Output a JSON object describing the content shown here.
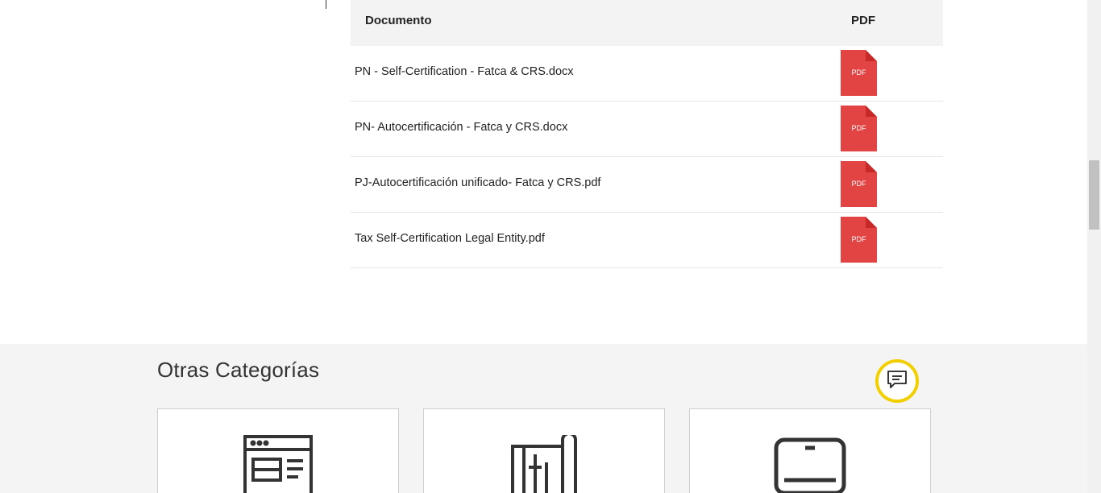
{
  "table": {
    "headers": {
      "document": "Documento",
      "pdf": "PDF"
    },
    "rows": [
      {
        "name": "PN - Self-Certification - Fatca & CRS.docx",
        "icon_label": "PDF"
      },
      {
        "name": "PN- Autocertificación - Fatca y CRS.docx",
        "icon_label": "PDF"
      },
      {
        "name": "PJ-Autocertificación unificado- Fatca y CRS.pdf",
        "icon_label": "PDF"
      },
      {
        "name": "Tax Self-Certification Legal Entity.pdf",
        "icon_label": "PDF"
      }
    ]
  },
  "other_categories": {
    "title": "Otras Categorías",
    "cards": [
      {
        "icon": "webpage-layout-icon"
      },
      {
        "icon": "blueprint-scroll-icon"
      },
      {
        "icon": "tablet-device-icon"
      }
    ]
  },
  "chat": {
    "icon": "chat-icon",
    "ring_color": "#f2cf00"
  },
  "colors": {
    "pdf_red": "#e24343",
    "pdf_fold": "#c72828",
    "header_bg": "#f3f3f3",
    "section_bg": "#f4f4f4"
  }
}
